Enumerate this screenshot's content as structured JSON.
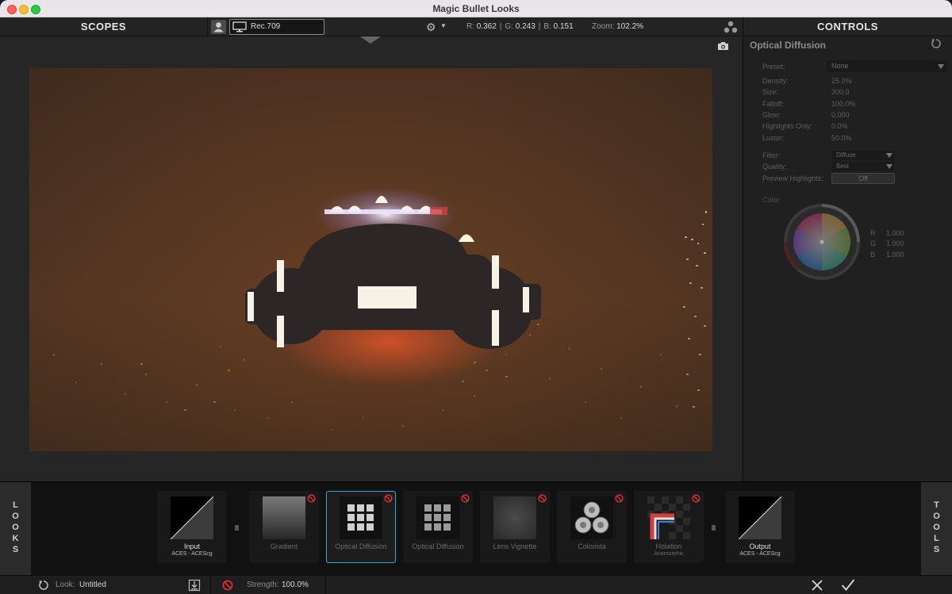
{
  "window": {
    "title": "Magic Bullet Looks"
  },
  "topbar": {
    "scopes_title": "SCOPES",
    "colorspace": "Rec.709",
    "rgb": {
      "r_label": "R:",
      "r": "0.362",
      "g_label": "G:",
      "g": "0.243",
      "b_label": "B:",
      "b": "0.151"
    },
    "zoom_label": "Zoom:",
    "zoom": "102.2%",
    "controls_title": "CONTROLS"
  },
  "controls": {
    "tool_name": "Optical Diffusion",
    "preset_label": "Preset:",
    "preset_value": "None",
    "params": [
      {
        "label": "Density:",
        "value": "25.0%"
      },
      {
        "label": "Size:",
        "value": "300.0"
      },
      {
        "label": "Falloff:",
        "value": "100.0%"
      },
      {
        "label": "Glow:",
        "value": "0.000"
      },
      {
        "label": "Highlights Only:",
        "value": "0.0%"
      },
      {
        "label": "Luster:",
        "value": "50.0%"
      }
    ],
    "filter_label": "Filter:",
    "filter_value": "Diffuse",
    "quality_label": "Quality:",
    "quality_value": "Best",
    "preview_label": "Preview Highlights:",
    "preview_value": "Off",
    "color_label": "Color",
    "color_rgb": [
      {
        "label": "R",
        "value": "1.000"
      },
      {
        "label": "G",
        "value": "1.000"
      },
      {
        "label": "B",
        "value": "1.000"
      }
    ]
  },
  "chain": {
    "left_tab": "LOOKS",
    "right_tab": "TOOLS",
    "tools": [
      {
        "label": "Input",
        "sub": "ACES - ACEScg"
      },
      {
        "label": "Gradient"
      },
      {
        "label": "Optical Diffusion"
      },
      {
        "label": "Optical Diffusion"
      },
      {
        "label": "Lens Vignette"
      },
      {
        "label": "Colorista"
      },
      {
        "label": "Holation",
        "sub": "Anamorphic"
      },
      {
        "label": "Output",
        "sub": "ACES - ACEScg"
      }
    ]
  },
  "status": {
    "look_label": "Look:",
    "look_name": "Untitled",
    "strength_label": "Strength:",
    "strength_value": "100.0%"
  },
  "colors": {
    "accent": "#3aa0de",
    "bypass_red": "#e03030",
    "frame_brown": "#5e3a22"
  }
}
